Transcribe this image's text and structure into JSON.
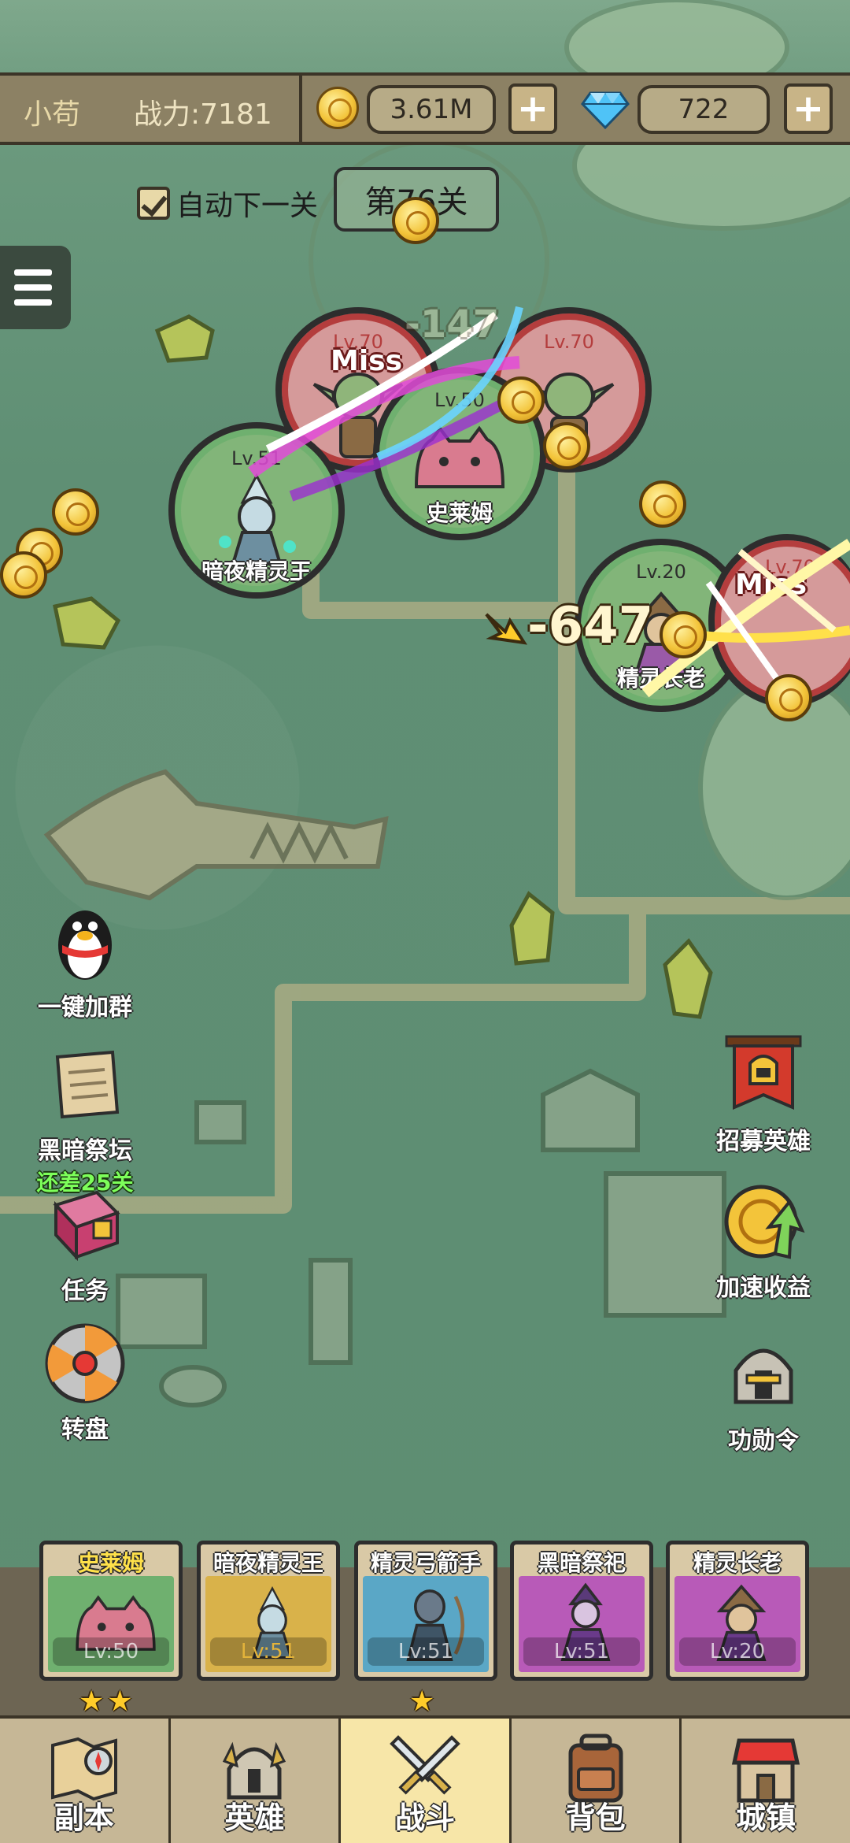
{
  "header": {
    "player_name": "小苟",
    "combat_power": "战力:7181",
    "coins": "3.61M",
    "gems": "722",
    "plus_symbol": "+"
  },
  "stage": {
    "auto_next_label": "自动下一关",
    "auto_next_checked": true,
    "stage_label": "第76关"
  },
  "battle": {
    "units": [
      {
        "side": "enemy",
        "level": "Lv.70",
        "status": "Miss",
        "name": ""
      },
      {
        "side": "enemy",
        "level": "Lv.70",
        "status": "",
        "name": ""
      },
      {
        "side": "ally",
        "level": "Lv.50",
        "status": "",
        "name": "史莱姆"
      },
      {
        "side": "ally",
        "level": "Lv.51",
        "status": "",
        "name": "暗夜精灵王"
      },
      {
        "side": "ally",
        "level": "Lv.20",
        "status": "",
        "name": "精灵长老"
      },
      {
        "side": "enemy",
        "level": "Lv.70",
        "status": "Miss",
        "name": ""
      }
    ],
    "damage_faint": "-147",
    "damage_main": "-647"
  },
  "features_left": [
    {
      "label": "一键加群",
      "sub": "",
      "icon": "penguin-icon"
    },
    {
      "label": "黑暗祭坛",
      "sub": "还差25关",
      "icon": "scroll-altar-icon"
    },
    {
      "label": "任务",
      "sub": "",
      "icon": "book-icon"
    },
    {
      "label": "转盘",
      "sub": "",
      "icon": "wheel-icon"
    }
  ],
  "features_right": [
    {
      "label": "招募英雄",
      "icon": "banner-helmet-icon"
    },
    {
      "label": "加速收益",
      "icon": "coin-arrow-icon"
    },
    {
      "label": "功勋令",
      "icon": "helmet-icon"
    }
  ],
  "heroes": [
    {
      "name": "史莱姆",
      "level": "Lv:50",
      "stars": "★★",
      "color": "#6fb06f"
    },
    {
      "name": "暗夜精灵王",
      "level": "Lv:51",
      "stars": "",
      "color": "#d9b24a"
    },
    {
      "name": "精灵弓箭手",
      "level": "Lv:51",
      "stars": "★",
      "color": "#5aa7c6"
    },
    {
      "name": "黑暗祭祀",
      "level": "Lv:51",
      "stars": "",
      "color": "#b85ab8"
    },
    {
      "name": "精灵长老",
      "level": "Lv:20",
      "stars": "",
      "color": "#b85ab8"
    }
  ],
  "nav": [
    {
      "label": "副本",
      "icon": "map-compass-icon",
      "active": false
    },
    {
      "label": "英雄",
      "icon": "knight-helmet-icon",
      "active": false
    },
    {
      "label": "战斗",
      "icon": "crossed-swords-icon",
      "active": true
    },
    {
      "label": "背包",
      "icon": "backpack-icon",
      "active": false
    },
    {
      "label": "城镇",
      "icon": "shop-house-icon",
      "active": false
    }
  ],
  "colors": {
    "map_green": "#5f8f74",
    "ally_ring": "#6fb06f",
    "enemy_ring": "#b43d3d",
    "accent_gold": "#f3c43a",
    "active_tab": "#f7e6a8"
  }
}
